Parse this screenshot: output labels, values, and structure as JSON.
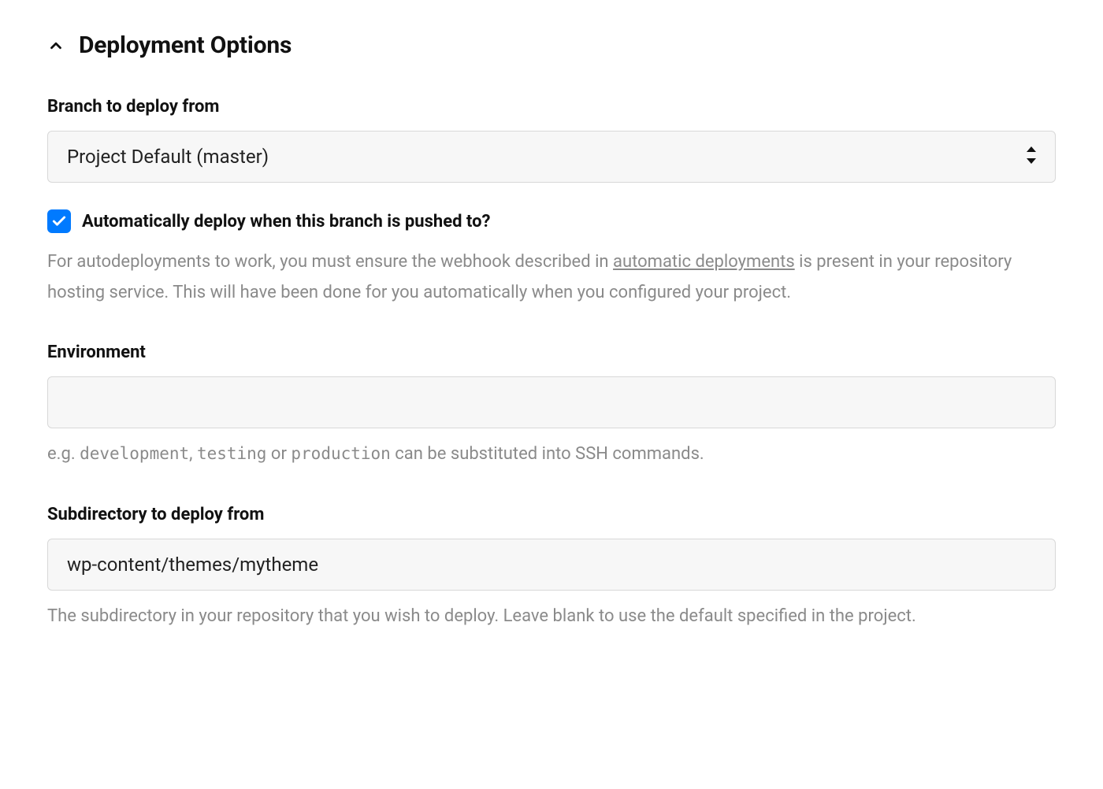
{
  "section": {
    "title": "Deployment Options"
  },
  "branch": {
    "label": "Branch to deploy from",
    "value": "Project Default (master)"
  },
  "autodeploy": {
    "checkbox_label": "Automatically deploy when this branch is pushed to?",
    "checked": true,
    "help_before": "For autodeployments to work, you must ensure the webhook described in ",
    "help_link_text": "automatic deployments",
    "help_after": " is present in your repository hosting service. This will have been done for you automatically when you configured your project."
  },
  "environment": {
    "label": "Environment",
    "value": "",
    "help_prefix": "e.g. ",
    "help_code1": "development",
    "help_sep1": ", ",
    "help_code2": "testing",
    "help_sep2": " or ",
    "help_code3": "production",
    "help_suffix": " can be substituted into SSH commands."
  },
  "subdirectory": {
    "label": "Subdirectory to deploy from",
    "value": "wp-content/themes/mytheme",
    "help": "The subdirectory in your repository that you wish to deploy. Leave blank to use the default specified in the project."
  }
}
